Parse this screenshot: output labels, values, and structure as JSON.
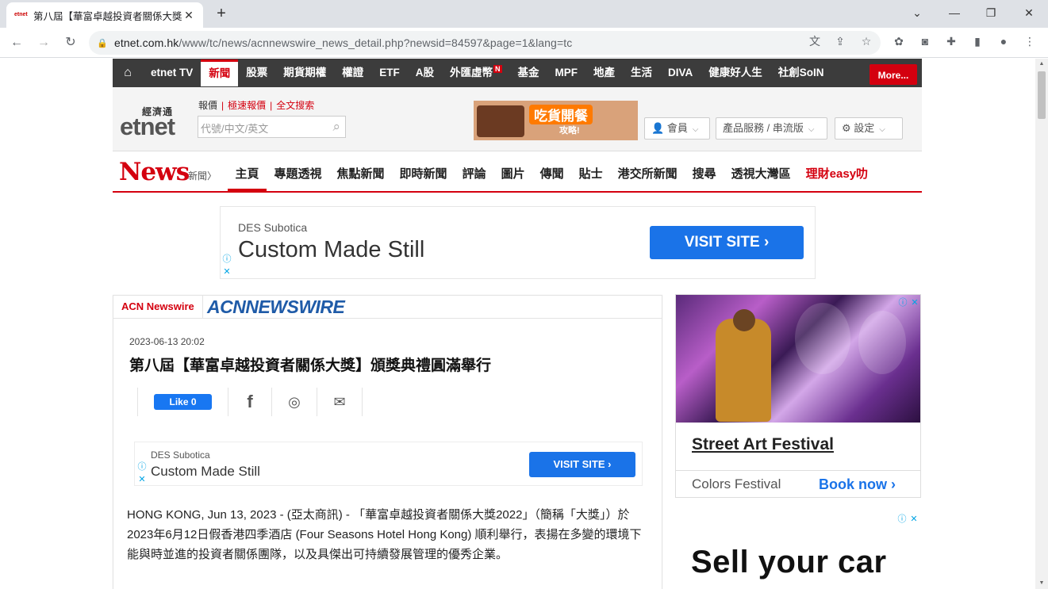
{
  "browser": {
    "tab_title": "第八屆【華富卓越投資者關係大獎",
    "favicon_text": "etnet",
    "url_host": "etnet.com.hk",
    "url_path": "/www/tc/news/acnnewswire_news_detail.php?newsid=84597&page=1&lang=tc"
  },
  "topnav": {
    "items": [
      "etnet TV",
      "新聞",
      "股票",
      "期貨期權",
      "權證",
      "ETF",
      "A股",
      "外匯虛幣",
      "基金",
      "MPF",
      "地產",
      "生活",
      "DIVA",
      "健康好人生",
      "社創SoIN"
    ],
    "badge": "N",
    "more": "More..."
  },
  "header": {
    "logo_cn": "經濟通",
    "logo_en_a": "et",
    "logo_en_b": "net",
    "links": [
      "報價",
      "極速報價",
      "全文搜索"
    ],
    "search_placeholder": "代號/中文/英文",
    "promo_title": "吃貨開餐",
    "promo_sub": "攻略!",
    "member": "會員",
    "products": "產品服務 / 串流版",
    "settings": "設定"
  },
  "newsnav": {
    "logo": "News",
    "logo_cn": "新聞〉",
    "tabs": [
      "主頁",
      "專題透視",
      "焦點新聞",
      "即時新聞",
      "評論",
      "圖片",
      "傳聞",
      "貼士",
      "港交所新聞",
      "搜尋",
      "透視大灣區",
      "理財easy叻"
    ]
  },
  "top_ad": {
    "advertiser": "DES Subotica",
    "headline": "Custom Made Still",
    "button": "VISIT SITE ›"
  },
  "article": {
    "source_label": "ACN Newswire",
    "source_logo": "ACNNEWSWIRE",
    "date": "2023-06-13 20:02",
    "title": "第八屆【華富卓越投資者關係大獎】頒獎典禮圓滿舉行",
    "fb_like": "Like 0",
    "inline_ad": {
      "advertiser": "DES Subotica",
      "headline": "Custom Made Still",
      "button": "VISIT SITE ›"
    },
    "body": "HONG KONG, Jun 13, 2023 - (亞太商訊) - 「華富卓越投資者關係大獎2022」（簡稱「大獎」）於2023年6月12日假香港四季酒店 (Four Seasons Hotel Hong Kong) 順利舉行，表揚在多變的環境下能與時並進的投資者關係團隊，以及具傑出可持續發展管理的優秀企業。"
  },
  "side_ad": {
    "title": "Street Art Festival",
    "subtitle": "Colors Festival",
    "cta": "Book now ›"
  },
  "side_ad2": {
    "headline": "Sell your car"
  }
}
